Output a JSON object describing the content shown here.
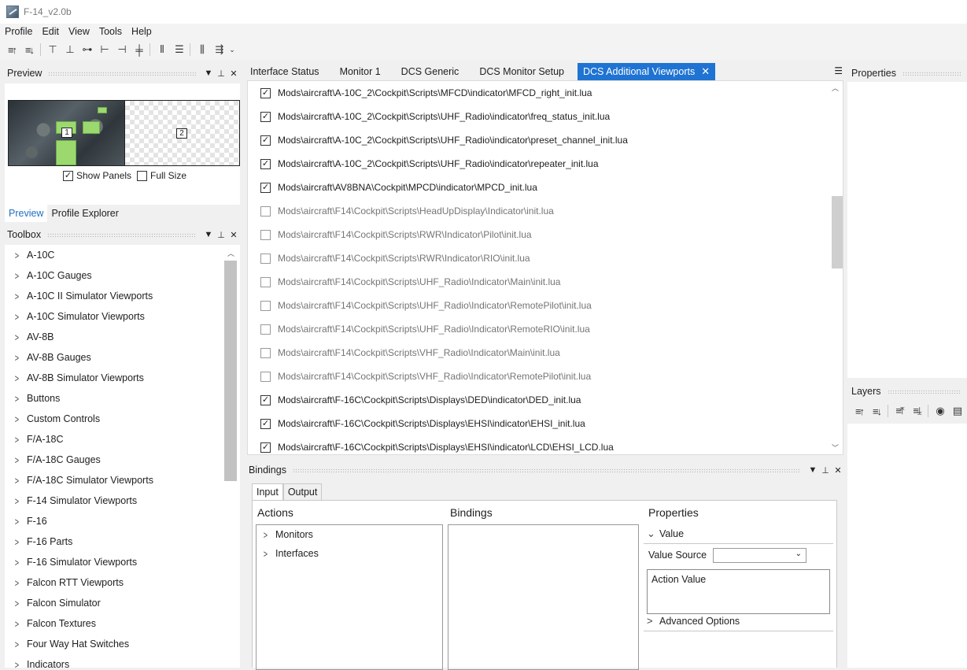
{
  "app": {
    "title": "F-14_v2.0b"
  },
  "menu": [
    "Profile",
    "Edit",
    "View",
    "Tools",
    "Help"
  ],
  "toolbar_icons": [
    "bring-forward-icon",
    "send-backward-icon",
    "align-top-icon",
    "align-bottom-icon",
    "align-middle-icon",
    "align-left-icon",
    "align-right-icon",
    "align-center-icon",
    "distribute-horizontal-icon",
    "distribute-vertical-icon",
    "space-horizontal-icon",
    "space-vertical-icon",
    "overflow-icon"
  ],
  "preview": {
    "title": "Preview",
    "monitor_labels": [
      "1",
      "2"
    ],
    "show_panels_label": "Show Panels",
    "show_panels_checked": true,
    "full_size_label": "Full Size",
    "full_size_checked": false,
    "tabs": [
      "Preview",
      "Profile Explorer"
    ]
  },
  "toolbox": {
    "title": "Toolbox",
    "items": [
      "A-10C",
      "A-10C Gauges",
      "A-10C II Simulator Viewports",
      "A-10C Simulator Viewports",
      "AV-8B",
      "AV-8B Gauges",
      "AV-8B Simulator Viewports",
      "Buttons",
      "Custom Controls",
      "F/A-18C",
      "F/A-18C Gauges",
      "F/A-18C Simulator Viewports",
      "F-14 Simulator Viewports",
      "F-16",
      "F-16 Parts",
      "F-16 Simulator Viewports",
      "Falcon RTT Viewports",
      "Falcon Simulator",
      "Falcon Textures",
      "Four Way Hat Switches",
      "Indicators"
    ]
  },
  "doc_tabs": [
    "Interface Status",
    "Monitor 1",
    "DCS Generic",
    "DCS Monitor Setup",
    "DCS Additional Viewports"
  ],
  "viewports": [
    {
      "path": "Mods\\aircraft\\A-10C_2\\Cockpit\\Scripts\\MFCD\\indicator\\MFCD_right_init.lua",
      "checked": true
    },
    {
      "path": "Mods\\aircraft\\A-10C_2\\Cockpit\\Scripts\\UHF_Radio\\indicator\\freq_status_init.lua",
      "checked": true
    },
    {
      "path": "Mods\\aircraft\\A-10C_2\\Cockpit\\Scripts\\UHF_Radio\\indicator\\preset_channel_init.lua",
      "checked": true
    },
    {
      "path": "Mods\\aircraft\\A-10C_2\\Cockpit\\Scripts\\UHF_Radio\\indicator\\repeater_init.lua",
      "checked": true
    },
    {
      "path": "Mods\\aircraft\\AV8BNA\\Cockpit\\MPCD\\indicator\\MPCD_init.lua",
      "checked": true
    },
    {
      "path": "Mods\\aircraft\\F14\\Cockpit\\Scripts\\HeadUpDisplay\\Indicator\\init.lua",
      "checked": false
    },
    {
      "path": "Mods\\aircraft\\F14\\Cockpit\\Scripts\\RWR\\Indicator\\Pilot\\init.lua",
      "checked": false
    },
    {
      "path": "Mods\\aircraft\\F14\\Cockpit\\Scripts\\RWR\\Indicator\\RIO\\init.lua",
      "checked": false
    },
    {
      "path": "Mods\\aircraft\\F14\\Cockpit\\Scripts\\UHF_Radio\\Indicator\\Main\\init.lua",
      "checked": false
    },
    {
      "path": "Mods\\aircraft\\F14\\Cockpit\\Scripts\\UHF_Radio\\Indicator\\RemotePilot\\init.lua",
      "checked": false
    },
    {
      "path": "Mods\\aircraft\\F14\\Cockpit\\Scripts\\UHF_Radio\\Indicator\\RemoteRIO\\init.lua",
      "checked": false
    },
    {
      "path": "Mods\\aircraft\\F14\\Cockpit\\Scripts\\VHF_Radio\\Indicator\\Main\\init.lua",
      "checked": false
    },
    {
      "path": "Mods\\aircraft\\F14\\Cockpit\\Scripts\\VHF_Radio\\Indicator\\RemotePilot\\init.lua",
      "checked": false
    },
    {
      "path": "Mods\\aircraft\\F-16C\\Cockpit\\Scripts\\Displays\\DED\\indicator\\DED_init.lua",
      "checked": true
    },
    {
      "path": "Mods\\aircraft\\F-16C\\Cockpit\\Scripts\\Displays\\EHSI\\indicator\\EHSI_init.lua",
      "checked": true
    },
    {
      "path": "Mods\\aircraft\\F-16C\\Cockpit\\Scripts\\Displays\\EHSI\\indicator\\LCD\\EHSI_LCD.lua",
      "checked": true
    }
  ],
  "bindings": {
    "title": "Bindings",
    "tabs": [
      "Input",
      "Output"
    ],
    "actions_header": "Actions",
    "bindings_header": "Bindings",
    "properties_header": "Properties",
    "action_items": [
      "Monitors",
      "Interfaces"
    ],
    "value_section": "Value",
    "value_source_label": "Value Source",
    "action_value_label": "Action Value",
    "advanced_label": "Advanced Options"
  },
  "properties_panel": {
    "title": "Properties"
  },
  "layers_panel": {
    "title": "Layers"
  },
  "colors": {
    "accent": "#1f73d2",
    "check_green": "#9bd96f"
  }
}
